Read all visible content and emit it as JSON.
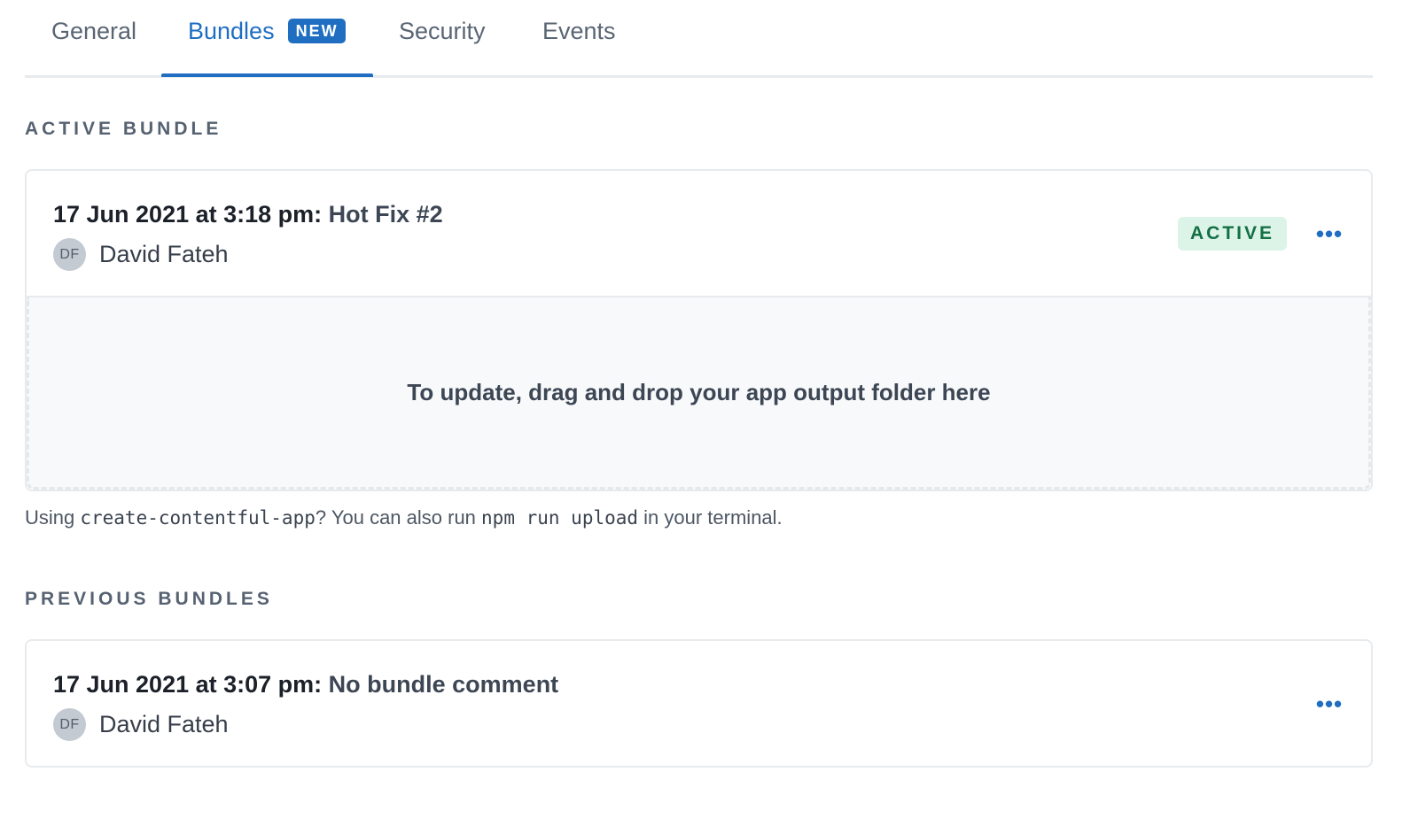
{
  "tabs": [
    {
      "label": "General"
    },
    {
      "label": "Bundles",
      "badge": "NEW",
      "selected": true
    },
    {
      "label": "Security"
    },
    {
      "label": "Events"
    }
  ],
  "active_section": {
    "heading": "ACTIVE BUNDLE",
    "bundle": {
      "date": "17 Jun 2021 at 3:18 pm:",
      "comment": "Hot Fix #2",
      "author_initials": "DF",
      "author_name": "David Fateh",
      "status": "ACTIVE",
      "menu_label": "•••"
    },
    "dropzone_text": "To update, drag and drop your app output folder here",
    "hint": {
      "prefix": "Using ",
      "code1": "create-contentful-app",
      "middle": "? You can also run ",
      "code2": "npm run upload",
      "suffix": " in your terminal."
    }
  },
  "previous_section": {
    "heading": "PREVIOUS BUNDLES",
    "bundles": [
      {
        "date": "17 Jun 2021 at 3:07 pm:",
        "comment": "No bundle comment",
        "author_initials": "DF",
        "author_name": "David Fateh",
        "menu_label": "•••"
      }
    ]
  },
  "colors": {
    "accent": "#1f6ec2",
    "active_badge_bg": "#dcf3e8",
    "active_badge_text": "#137044"
  }
}
